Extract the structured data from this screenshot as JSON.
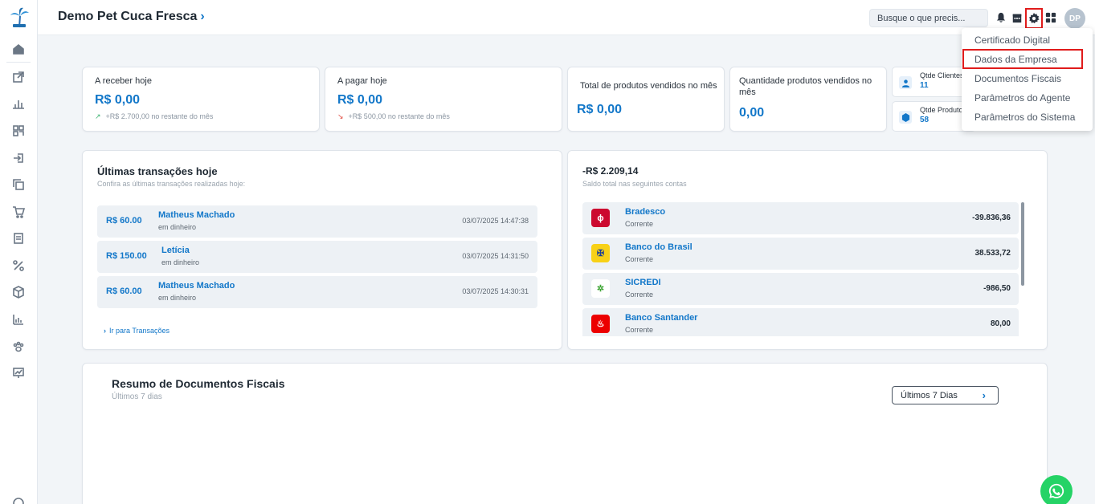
{
  "header": {
    "company_name": "Demo Pet Cuca Fresca",
    "search_placeholder": "Busque o que precis...",
    "avatar_initials": "DP"
  },
  "kpis": [
    {
      "label": "A receber hoje",
      "value": "R$ 0,00",
      "sub": "+R$ 2.700,00 no restante do mês",
      "trend": "up"
    },
    {
      "label": "A pagar hoje",
      "value": "R$ 0,00",
      "sub": "+R$ 500,00 no restante do mês",
      "trend": "down"
    },
    {
      "label": "Total de produtos vendidos no mês",
      "value": "R$ 0,00"
    },
    {
      "label": "Quantidade produtos vendidos no mês",
      "value": "0,00"
    }
  ],
  "mini_cards": [
    {
      "label": "Qtde Clientes",
      "value": "11",
      "icon": "user-icon"
    },
    {
      "label": "Qtde Produtos",
      "value": "58",
      "icon": "box-icon"
    }
  ],
  "transactions": {
    "title": "Últimas transações hoje",
    "subtitle": "Confira as últimas transações realizadas hoje:",
    "items": [
      {
        "amount": "R$ 60.00",
        "name": "Matheus Machado",
        "method": "em dinheiro",
        "date": "03/07/2025 14:47:38"
      },
      {
        "amount": "R$ 150.00",
        "name": "Letícia",
        "method": "em dinheiro",
        "date": "03/07/2025 14:31:50"
      },
      {
        "amount": "R$ 60.00",
        "name": "Matheus Machado",
        "method": "em dinheiro",
        "date": "03/07/2025 14:30:31"
      }
    ],
    "link": "Ir para Transações"
  },
  "accounts": {
    "total": "-R$ 2.209,14",
    "subtitle": "Saldo total nas seguintes contas",
    "items": [
      {
        "name": "Bradesco",
        "type": "Corrente",
        "balance": "-39.836,36",
        "color": "#cc092f"
      },
      {
        "name": "Banco do Brasil",
        "type": "Corrente",
        "balance": "38.533,72",
        "color": "#f8d117"
      },
      {
        "name": "SICREDI",
        "type": "Corrente",
        "balance": "-986,50",
        "color": "#3fa535"
      },
      {
        "name": "Banco Santander",
        "type": "Corrente",
        "balance": "80,00",
        "color": "#ec0000"
      }
    ]
  },
  "fiscal": {
    "title": "Resumo de Documentos Fiscais",
    "subtitle": "Últimos 7 dias",
    "period_button": "Últimos 7 Dias"
  },
  "settings_menu": {
    "items": [
      "Certificado Digital",
      "Dados da Empresa",
      "Documentos Fiscais",
      "Parâmetros do Agente",
      "Parâmetros do Sistema"
    ]
  },
  "colors": {
    "accent": "#1277c9",
    "highlight": "#e01b1b",
    "whatsapp": "#25d366"
  }
}
